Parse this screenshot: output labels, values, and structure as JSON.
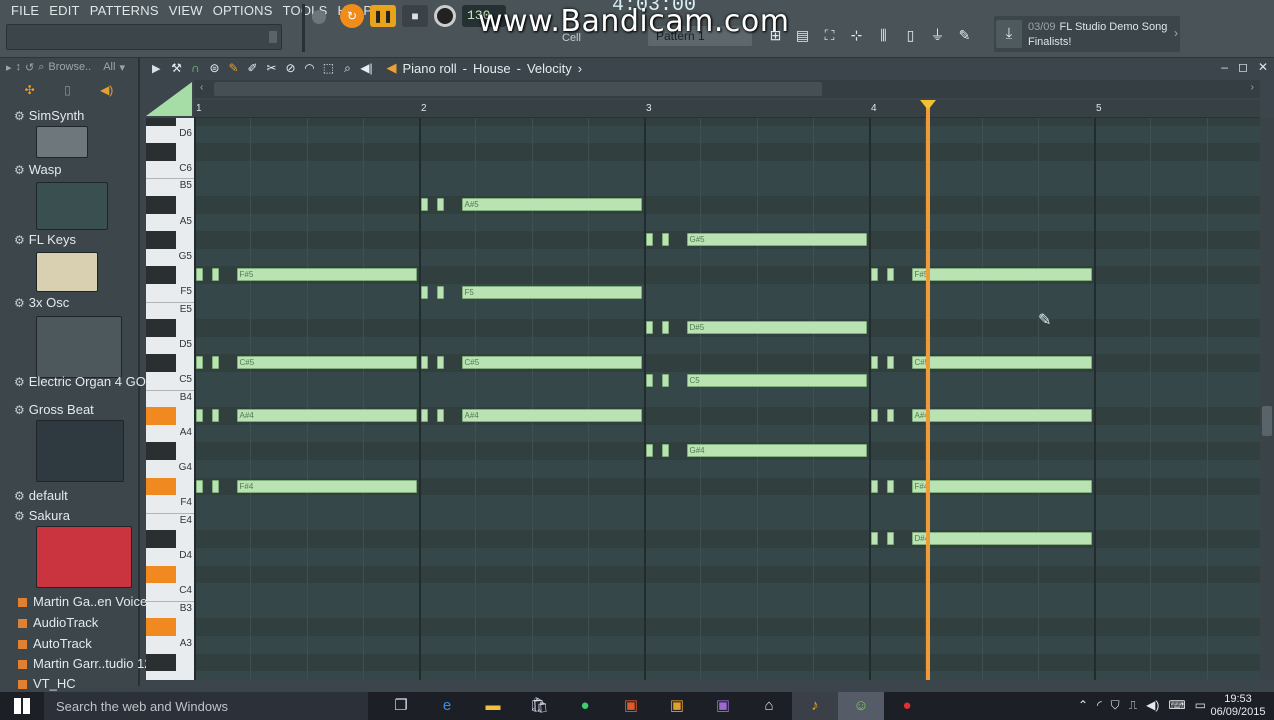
{
  "menu": [
    "FILE",
    "EDIT",
    "PATTERNS",
    "VIEW",
    "OPTIONS",
    "TOOLS",
    "HELP"
  ],
  "transport": {
    "tempo": "130",
    "time": "4:03:00",
    "pattern": "Pattern 1",
    "snap": "Cell"
  },
  "watermark": "www.Bandicam.com",
  "hint": {
    "counter": "03/09",
    "line1": "FL Studio Demo Song",
    "line2": "Finalists!"
  },
  "browser": {
    "label": "Browse..",
    "filter": "All"
  },
  "sidebar_items": [
    {
      "label": "SimSynth",
      "kind": "gen"
    },
    {
      "label": "Wasp",
      "kind": "gen"
    },
    {
      "label": "FL Keys",
      "kind": "gen"
    },
    {
      "label": "3x Osc",
      "kind": "gen"
    },
    {
      "label": "Electric Organ 4 GOL",
      "kind": "gen"
    },
    {
      "label": "Gross Beat",
      "kind": "gen"
    },
    {
      "label": "default",
      "kind": "gen"
    },
    {
      "label": "Sakura",
      "kind": "gen"
    },
    {
      "label": "Martin Ga..en Voices",
      "kind": "pl"
    },
    {
      "label": "AudioTrack",
      "kind": "pl"
    },
    {
      "label": "AutoTrack",
      "kind": "pl"
    },
    {
      "label": "Martin Garr..tudio 12",
      "kind": "pl"
    },
    {
      "label": "VT_HC",
      "kind": "pl"
    }
  ],
  "piano_roll": {
    "title": "Piano roll",
    "channel": "House",
    "target": "Velocity",
    "bars": [
      "1",
      "2",
      "3",
      "4",
      "5"
    ]
  },
  "key_labels": [
    "D6",
    "C6",
    "B5",
    "A5",
    "G5",
    "F5",
    "E5",
    "D5",
    "C5",
    "B4",
    "A4",
    "G4",
    "F4",
    "E4",
    "D4",
    "C4",
    "B3",
    "A3"
  ],
  "notes": [
    {
      "label": "A#5",
      "pitch": "A#5",
      "bar": 2,
      "start": 0.18,
      "len": 0.82
    },
    {
      "label": "G#5",
      "pitch": "G#5",
      "bar": 3,
      "start": 0.18,
      "len": 0.82
    },
    {
      "label": "F#5",
      "pitch": "F#5",
      "bar": 1,
      "start": 0.18,
      "len": 0.82
    },
    {
      "label": "F#5",
      "pitch": "F#5",
      "bar": 4,
      "start": 0.18,
      "len": 0.82
    },
    {
      "label": "F5",
      "pitch": "F5",
      "bar": 2,
      "start": 0.18,
      "len": 0.82
    },
    {
      "label": "D#5",
      "pitch": "D#5",
      "bar": 3,
      "start": 0.18,
      "len": 0.82
    },
    {
      "label": "C#5",
      "pitch": "C#5",
      "bar": 1,
      "start": 0.18,
      "len": 0.82
    },
    {
      "label": "C#5",
      "pitch": "C#5",
      "bar": 2,
      "start": 0.18,
      "len": 0.82
    },
    {
      "label": "C#5",
      "pitch": "C#5",
      "bar": 4,
      "start": 0.18,
      "len": 0.82
    },
    {
      "label": "C5",
      "pitch": "C5",
      "bar": 3,
      "start": 0.18,
      "len": 0.82
    },
    {
      "label": "A#4",
      "pitch": "A#4",
      "bar": 1,
      "start": 0.18,
      "len": 0.82
    },
    {
      "label": "A#4",
      "pitch": "A#4",
      "bar": 2,
      "start": 0.18,
      "len": 0.82
    },
    {
      "label": "A#4",
      "pitch": "A#4",
      "bar": 4,
      "start": 0.18,
      "len": 0.82
    },
    {
      "label": "G#4",
      "pitch": "G#4",
      "bar": 3,
      "start": 0.18,
      "len": 0.82
    },
    {
      "label": "F#4",
      "pitch": "F#4",
      "bar": 1,
      "start": 0.18,
      "len": 0.82
    },
    {
      "label": "F#4",
      "pitch": "F#4",
      "bar": 4,
      "start": 0.18,
      "len": 0.82
    },
    {
      "label": "D#4",
      "pitch": "D#4",
      "bar": 4,
      "start": 0.18,
      "len": 0.82
    }
  ],
  "playhead_bar": 4.26,
  "taskbar": {
    "search_placeholder": "Search the web and Windows",
    "time": "19:53",
    "date": "06/09/2015"
  },
  "colors": {
    "note": "#b9e3b3",
    "playhead": "#ef9b3a",
    "accent": "#f08a20"
  }
}
